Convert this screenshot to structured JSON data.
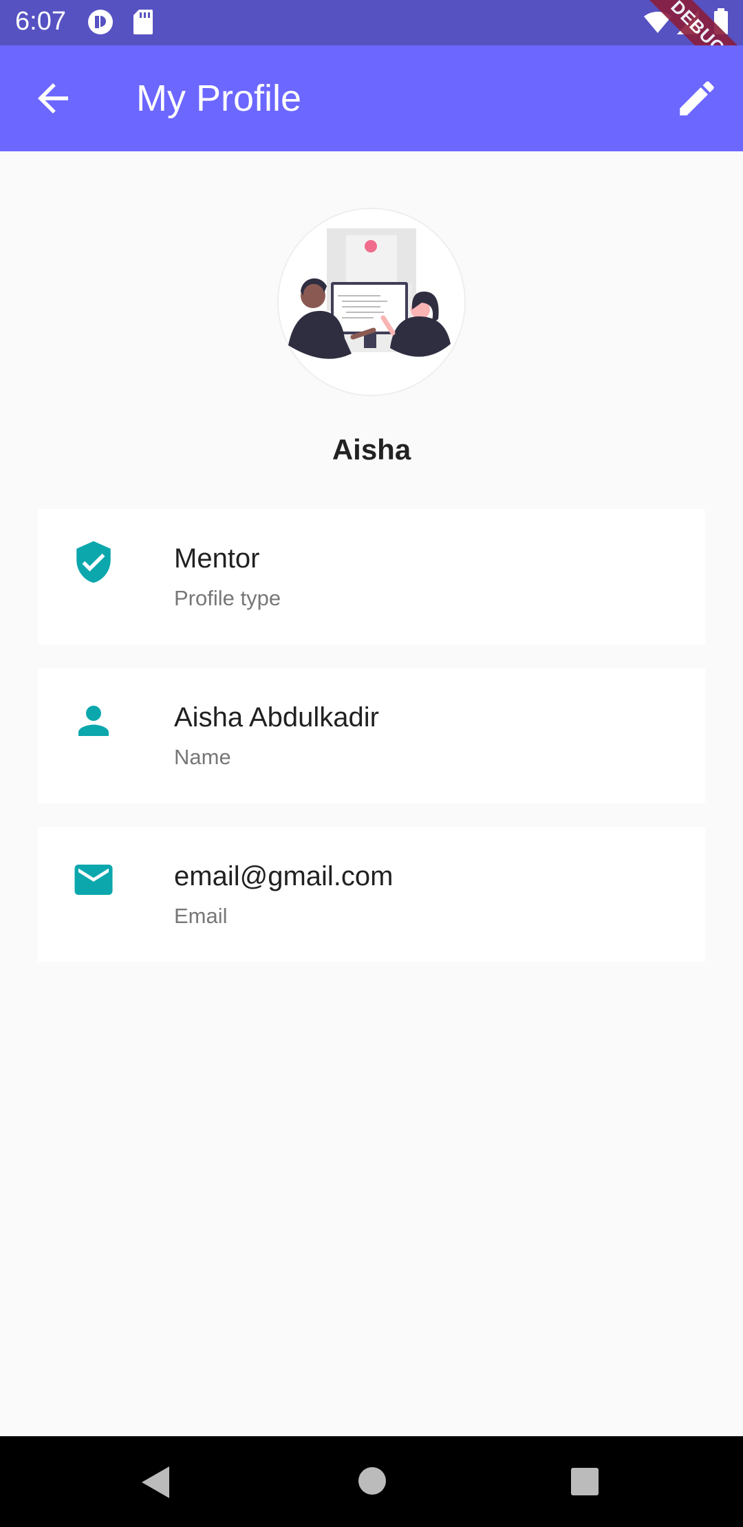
{
  "status_bar": {
    "time": "6:07",
    "debug_label": "DEBUG",
    "icons": [
      "app-notification-icon",
      "sd-card-icon",
      "wifi-icon",
      "cell-signal-icon",
      "battery-icon"
    ]
  },
  "app_bar": {
    "title": "My Profile",
    "back_icon": "arrow-back-icon",
    "edit_icon": "pencil-icon"
  },
  "profile": {
    "display_name": "Aisha",
    "avatar_icon": "two-people-at-computer-illustration"
  },
  "cards": [
    {
      "icon": "verified-shield-icon",
      "title": "Mentor",
      "subtitle": "Profile type"
    },
    {
      "icon": "person-icon",
      "title": "Aisha Abdulkadir",
      "subtitle": "Name"
    },
    {
      "icon": "email-icon",
      "title": "email@gmail.com",
      "subtitle": "Email"
    }
  ],
  "nav_bar": {
    "icons": [
      "back-triangle-icon",
      "home-circle-icon",
      "recents-square-icon"
    ]
  },
  "colors": {
    "status_bar": "#5652c2",
    "app_bar": "#6c67ff",
    "accent_teal": "#0ba7ad",
    "background": "#fafafa"
  }
}
